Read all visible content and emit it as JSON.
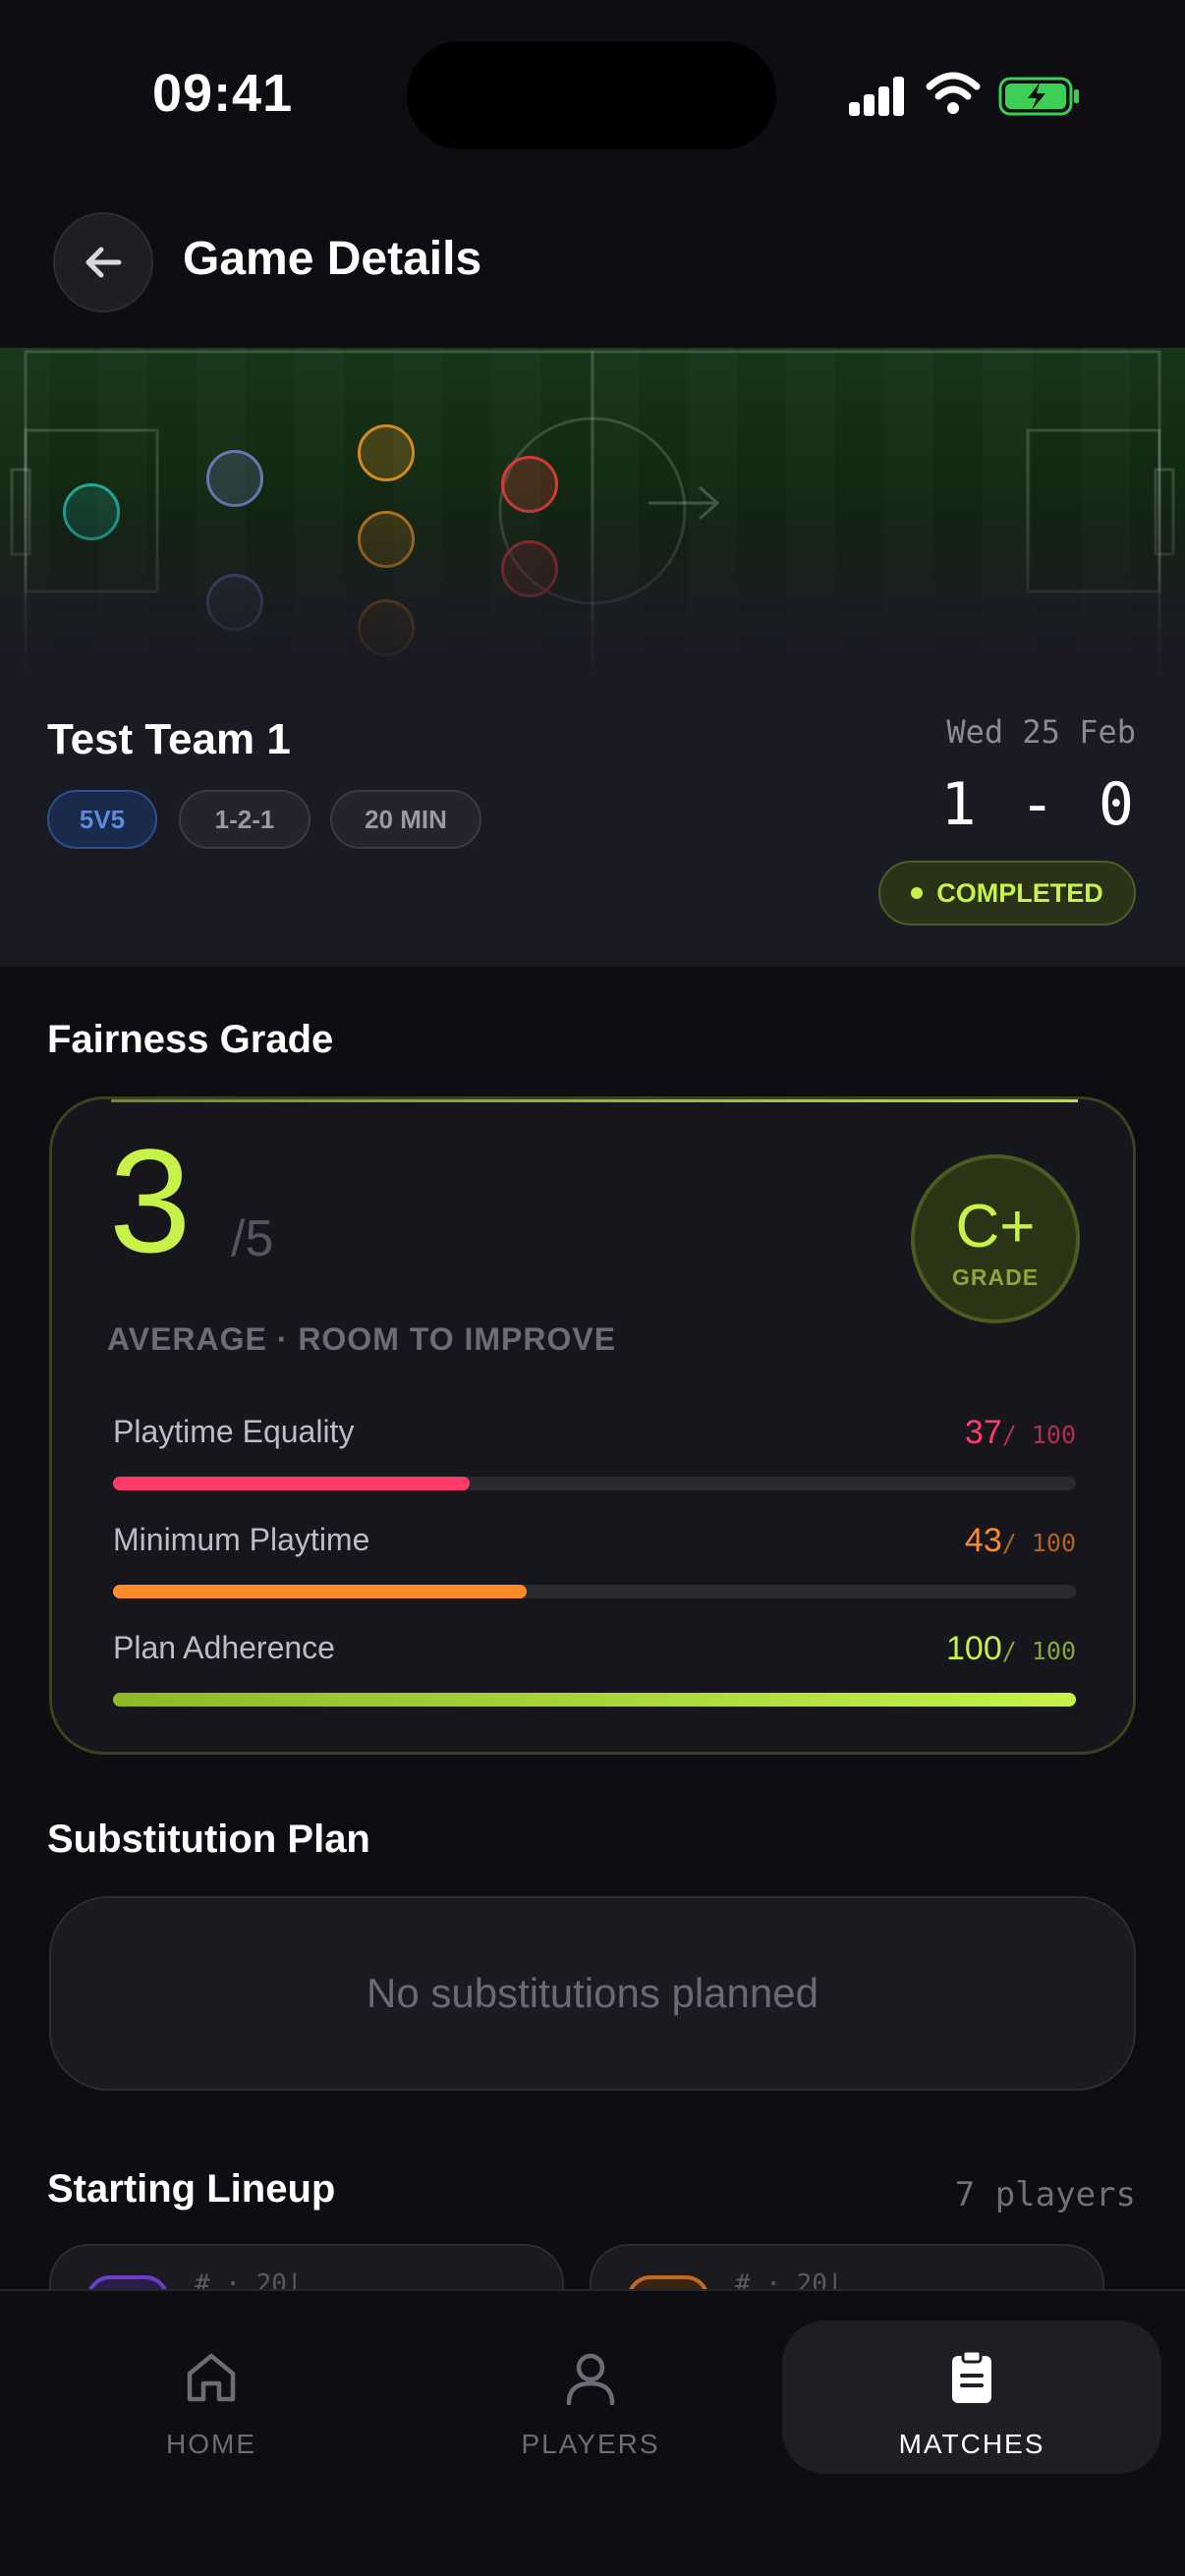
{
  "status_bar": {
    "time": "09:41"
  },
  "header": {
    "title": "Game Details"
  },
  "game": {
    "team": "Test Team 1",
    "chips": [
      "5V5",
      "1-2-1",
      "20 MIN"
    ],
    "date": "Wed 25 Feb",
    "score": "1 - 0",
    "status": "COMPLETED"
  },
  "fairness": {
    "section_title": "Fairness Grade",
    "score": "3",
    "out_of": "/5",
    "grade": "C+",
    "grade_label": "GRADE",
    "subtitle": "AVERAGE · ROOM TO IMPROVE",
    "metrics": [
      {
        "label": "Playtime Equality",
        "value": "37",
        "of": "/ 100",
        "percent": 37,
        "color": "#ff3b6b"
      },
      {
        "label": "Minimum Playtime",
        "value": "43",
        "of": "/ 100",
        "percent": 43,
        "color": "#ff8a2a"
      },
      {
        "label": "Plan Adherence",
        "value": "100",
        "of": "/ 100",
        "percent": 100,
        "color": "#c6f24a"
      }
    ]
  },
  "substitution": {
    "section_title": "Substitution Plan",
    "empty_text": "No substitutions planned"
  },
  "lineup": {
    "section_title": "Starting Lineup",
    "count": "7 players",
    "cards": [
      {
        "text": "# · 20|"
      },
      {
        "text": "# · 20|"
      }
    ]
  },
  "nav": {
    "items": [
      {
        "label": "HOME",
        "icon": "home-icon"
      },
      {
        "label": "PLAYERS",
        "icon": "person-icon"
      },
      {
        "label": "MATCHES",
        "icon": "clipboard-icon"
      }
    ],
    "active": "MATCHES"
  },
  "colors": {
    "accent": "#c6f24a",
    "background": "#0d0d12"
  }
}
